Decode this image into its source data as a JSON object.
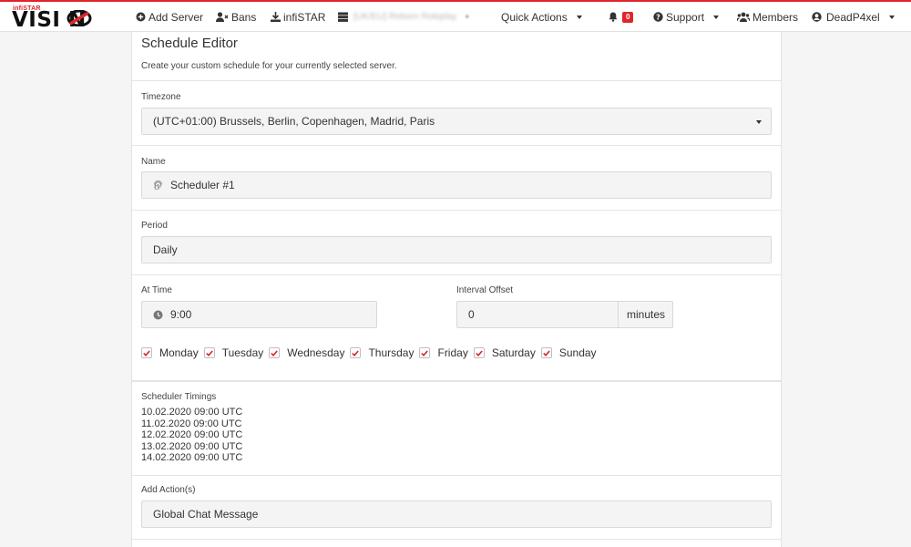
{
  "navbar": {
    "logo_small": "infiSTAR",
    "logo_big": "VISI N",
    "add_server": "Add Server",
    "bans": "Bans",
    "infistar": "infiSTAR",
    "server_name": "[UK/EU] Reborn Roleplay",
    "quick_actions": "Quick Actions",
    "notifications_count": "0",
    "support": "Support",
    "members": "Members",
    "user": "DeadP4xel",
    "accent_color": "#e0252a"
  },
  "editor": {
    "title": "Schedule Editor",
    "subtitle": "Create your custom schedule for your currently selected server.",
    "timezone": {
      "label": "Timezone",
      "value": "(UTC+01:00) Brussels, Berlin, Copenhagen, Madrid, Paris"
    },
    "name": {
      "label": "Name",
      "value": "Scheduler #1"
    },
    "period": {
      "label": "Period",
      "value": "Daily"
    },
    "at_time": {
      "label": "At Time",
      "value": "9:00"
    },
    "interval_offset": {
      "label": "Interval Offset",
      "value": "0",
      "unit": "minutes"
    },
    "days": [
      {
        "label": "Monday",
        "checked": true
      },
      {
        "label": "Tuesday",
        "checked": true
      },
      {
        "label": "Wednesday",
        "checked": true
      },
      {
        "label": "Thursday",
        "checked": true
      },
      {
        "label": "Friday",
        "checked": true
      },
      {
        "label": "Saturday",
        "checked": true
      },
      {
        "label": "Sunday",
        "checked": true
      }
    ],
    "timings": {
      "label": "Scheduler Timings",
      "items": [
        "10.02.2020 09:00 UTC",
        "11.02.2020 09:00 UTC",
        "12.02.2020 09:00 UTC",
        "13.02.2020 09:00 UTC",
        "14.02.2020 09:00 UTC"
      ]
    },
    "actions": {
      "label": "Add Action(s)",
      "value": "Global Chat Message"
    }
  }
}
